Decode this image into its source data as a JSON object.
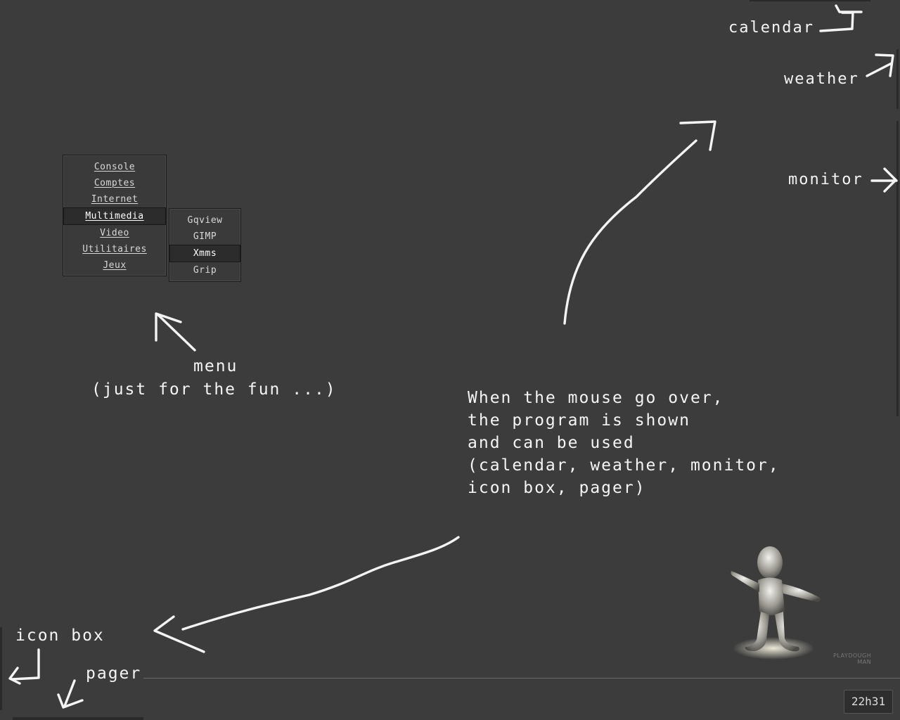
{
  "menu": {
    "items": [
      "Console",
      "Comptes",
      "Internet",
      "Multimedia",
      "Video",
      "Utilitaires",
      "Jeux"
    ],
    "selected_item": "Multimedia",
    "submenu": [
      "Gqview",
      "GIMP",
      "Xmms",
      "Grip"
    ],
    "submenu_selected": "Xmms"
  },
  "annotations": {
    "calendar": "calendar",
    "weather": "weather",
    "monitor": "monitor",
    "menu_title": "menu",
    "menu_sub": "(just for the fun ...)",
    "hover_note": [
      "When the mouse go over,",
      "the program is shown",
      "and can be used",
      "(calendar, weather, monitor,",
      "icon box, pager)"
    ],
    "icon_box": "icon box",
    "pager": "pager"
  },
  "clock": {
    "time": "22h31"
  },
  "logo": {
    "line1": "PLAYDOUGH",
    "line2": "MAN"
  },
  "colors": {
    "background": "#3c3c3c",
    "ink": "#f4f4f4",
    "panel": "#2a2a2a"
  }
}
